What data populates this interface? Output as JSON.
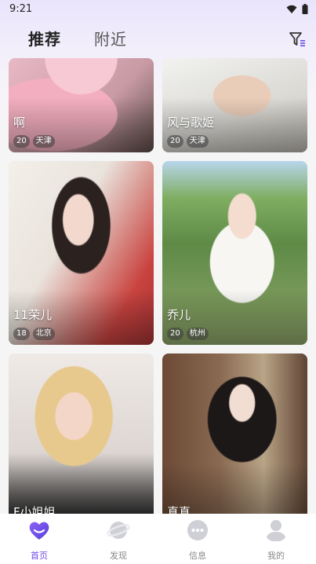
{
  "status": {
    "time": "9:21"
  },
  "tabs": [
    {
      "label": "推荐",
      "active": true
    },
    {
      "label": "附近",
      "active": false
    }
  ],
  "header": {
    "filter_icon": "filter-icon"
  },
  "cards": [
    {
      "name": "啊",
      "age": "20",
      "city": "天津"
    },
    {
      "name": "风与歌姬",
      "age": "20",
      "city": "天津"
    },
    {
      "name": "11荣儿",
      "age": "18",
      "city": "北京"
    },
    {
      "name": "乔儿",
      "age": "20",
      "city": "杭州"
    },
    {
      "name": "F小姐姐",
      "age": "",
      "city": ""
    },
    {
      "name": "真真",
      "age": "",
      "city": ""
    }
  ],
  "nav": [
    {
      "label": "首页",
      "icon": "heart-icon",
      "active": true
    },
    {
      "label": "发现",
      "icon": "planet-icon",
      "active": false
    },
    {
      "label": "信息",
      "icon": "chat-icon",
      "active": false
    },
    {
      "label": "我的",
      "icon": "user-icon",
      "active": false
    }
  ],
  "colors": {
    "accent": "#6f4de6",
    "background": "#f5f5f5"
  }
}
